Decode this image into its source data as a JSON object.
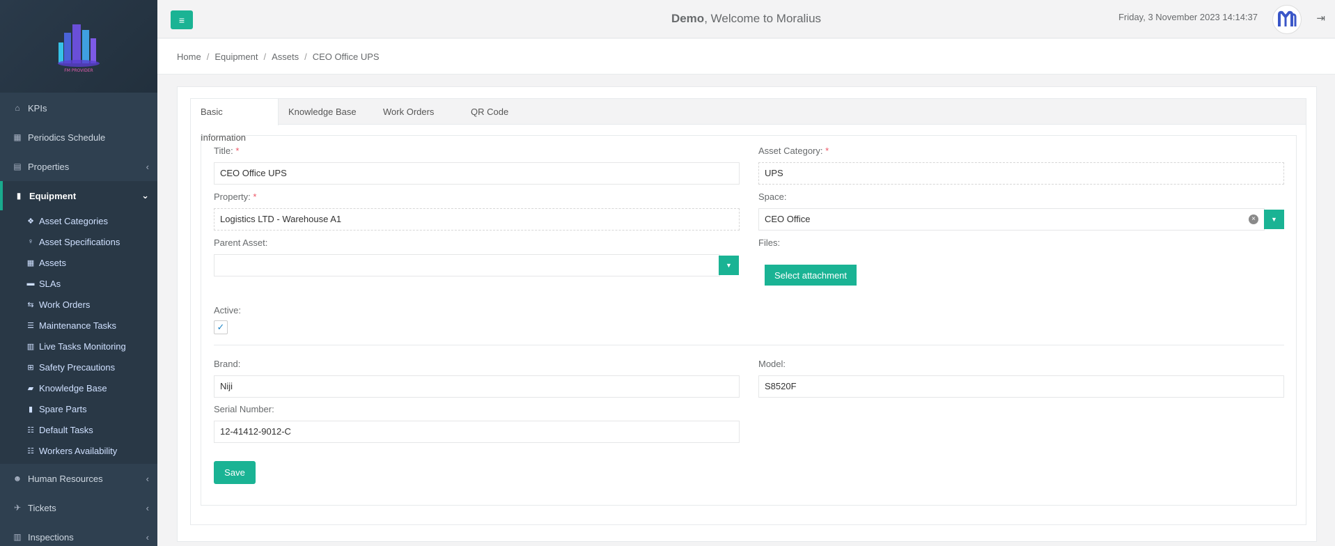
{
  "app": {
    "logo_text": "FM PROVIDER",
    "user": "Demo",
    "welcome_suffix": ", Welcome to Moralius",
    "datetime": "Friday, 3 November 2023 14:14:37"
  },
  "sidebar": {
    "items": [
      {
        "label": "KPIs",
        "icon": "home-icon"
      },
      {
        "label": "Periodics Schedule",
        "icon": "calendar-icon"
      },
      {
        "label": "Properties",
        "icon": "building-icon"
      },
      {
        "label": "Equipment",
        "icon": "device-icon"
      },
      {
        "label": "Human Resources",
        "icon": "users-icon"
      },
      {
        "label": "Tickets",
        "icon": "ticket-icon"
      },
      {
        "label": "Inspections",
        "icon": "map-icon"
      }
    ],
    "equipment_sub": [
      {
        "label": "Asset Categories",
        "icon": "cubes-icon"
      },
      {
        "label": "Asset Specifications",
        "icon": "lightbulb-icon"
      },
      {
        "label": "Assets",
        "icon": "grid-icon"
      },
      {
        "label": "SLAs",
        "icon": "truck-icon"
      },
      {
        "label": "Work Orders",
        "icon": "exchange-icon"
      },
      {
        "label": "Maintenance Tasks",
        "icon": "list-icon"
      },
      {
        "label": "Live Tasks Monitoring",
        "icon": "map-icon"
      },
      {
        "label": "Safety Precautions",
        "icon": "medkit-icon"
      },
      {
        "label": "Knowledge Base",
        "icon": "book-icon"
      },
      {
        "label": "Spare Parts",
        "icon": "cylinder-icon"
      },
      {
        "label": "Default Tasks",
        "icon": "list-ol-icon"
      },
      {
        "label": "Workers Availability",
        "icon": "list-ol-icon"
      }
    ]
  },
  "breadcrumb": [
    "Home",
    "Equipment",
    "Assets",
    "CEO Office UPS"
  ],
  "tabs": [
    "Basic Information",
    "Knowledge Base",
    "Work Orders",
    "QR Code"
  ],
  "form": {
    "title_label": "Title:",
    "title_value": "CEO Office UPS",
    "asset_category_label": "Asset Category:",
    "asset_category_value": "UPS",
    "property_label": "Property:",
    "property_value": "Logistics LTD - Warehouse A1",
    "space_label": "Space:",
    "space_value": "CEO Office",
    "parent_asset_label": "Parent Asset:",
    "parent_asset_value": "",
    "files_label": "Files:",
    "select_attachment": "Select attachment",
    "active_label": "Active:",
    "active_checked": true,
    "brand_label": "Brand:",
    "brand_value": "Niji",
    "model_label": "Model:",
    "model_value": "S8520F",
    "serial_label": "Serial Number:",
    "serial_value": "12-41412-9012-C",
    "required_mark": "*",
    "save": "Save"
  },
  "colors": {
    "sidebar_bg": "#2f4050",
    "accent": "#1ab394",
    "required": "#ed5565"
  }
}
